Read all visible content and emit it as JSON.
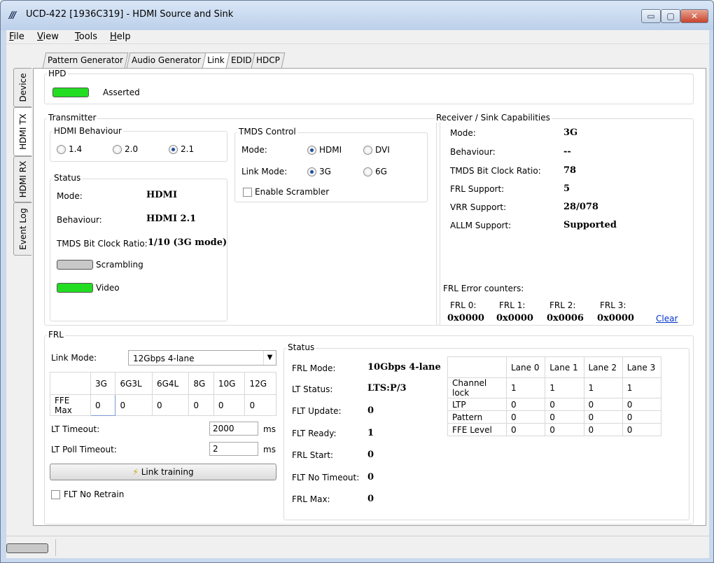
{
  "window": {
    "title": "UCD-422 [1936C319] - HDMI Source and Sink",
    "controls": {
      "minimize": "▭",
      "maximize": "▢",
      "close": "✕"
    }
  },
  "menu": [
    {
      "label": "File",
      "accel": "F",
      "rest": "ile"
    },
    {
      "label": "View",
      "accel": "V",
      "rest": "iew"
    },
    {
      "label": "Tools",
      "accel": "T",
      "rest": "ools"
    },
    {
      "label": "Help",
      "accel": "H",
      "rest": "elp"
    }
  ],
  "side_tabs": [
    "Device",
    "HDMI TX",
    "HDMI RX",
    "Event Log"
  ],
  "side_tab_active": "HDMI TX",
  "tabs": [
    "Pattern Generator",
    "Audio Generator",
    "Link",
    "EDID",
    "HDCP"
  ],
  "tab_active": "Link",
  "hpd": {
    "title": "HPD",
    "state": "Asserted",
    "led_color": "#22dd22"
  },
  "transmitter": {
    "title": "Transmitter",
    "behaviour": {
      "title": "HDMI Behaviour",
      "options": [
        "1.4",
        "2.0",
        "2.1"
      ],
      "selected": "2.1"
    },
    "status": {
      "title": "Status",
      "mode_label": "Mode:",
      "mode": "HDMI",
      "behaviour_label": "Behaviour:",
      "behaviour": "HDMI 2.1",
      "ratio_label": "TMDS Bit Clock Ratio:",
      "ratio": "1/10 (3G mode)",
      "scrambling_label": "Scrambling",
      "scrambling_led": "#c8c8c8",
      "video_label": "Video",
      "video_led": "#22dd22"
    },
    "tmds": {
      "title": "TMDS Control",
      "mode_label": "Mode:",
      "mode_options": [
        "HDMI",
        "DVI"
      ],
      "mode_selected": "HDMI",
      "link_label": "Link Mode:",
      "link_options": [
        "3G",
        "6G"
      ],
      "link_selected": "3G",
      "scrambler_label": "Enable Scrambler"
    }
  },
  "receiver": {
    "title": "Receiver / Sink Capabilities",
    "rows": [
      {
        "label": "Mode:",
        "value": "3G"
      },
      {
        "label": "Behaviour:",
        "value": "--"
      },
      {
        "label": "TMDS Bit Clock Ratio:",
        "value": "78"
      },
      {
        "label": "FRL Support:",
        "value": "5"
      },
      {
        "label": "VRR Support:",
        "value": "28/078"
      },
      {
        "label": "ALLM Support:",
        "value": "Supported"
      }
    ],
    "error_title": "FRL Error counters:",
    "errors": [
      {
        "label": "FRL 0:",
        "value": "0x0000"
      },
      {
        "label": "FRL 1:",
        "value": "0x0000"
      },
      {
        "label": "FRL 2:",
        "value": "0x0006"
      },
      {
        "label": "FRL 3:",
        "value": "0x0000"
      }
    ],
    "clear_label": "Clear"
  },
  "frl": {
    "title": "FRL",
    "link_mode_label": "Link Mode:",
    "link_mode_value": "12Gbps 4-lane",
    "ffe_headers": [
      "",
      "3G",
      "6G3L",
      "6G4L",
      "8G",
      "10G",
      "12G"
    ],
    "ffe_row": [
      "FFE Max",
      "0",
      "0",
      "0",
      "0",
      "0",
      "0"
    ],
    "lt_timeout_label": "LT Timeout:",
    "lt_timeout": "2000",
    "lt_timeout_unit": "ms",
    "lt_poll_label": "LT Poll Timeout:",
    "lt_poll": "2",
    "lt_poll_unit": "ms",
    "link_training_label": "Link training",
    "no_retrain_label": "FLT No Retrain"
  },
  "frl_status": {
    "title": "Status",
    "rows": [
      {
        "label": "FRL Mode:",
        "value": "10Gbps 4-lane"
      },
      {
        "label": "LT Status:",
        "value": "LTS:P/3"
      },
      {
        "label": "FLT Update:",
        "value": "0"
      },
      {
        "label": "FLT Ready:",
        "value": "1"
      },
      {
        "label": "FRL Start:",
        "value": "0"
      },
      {
        "label": "FLT No Timeout:",
        "value": "0"
      },
      {
        "label": "FRL Max:",
        "value": "0"
      }
    ],
    "lane_headers": [
      "",
      "Lane 0",
      "Lane 1",
      "Lane 2",
      "Lane 3"
    ],
    "lane_rows": [
      [
        "Channel lock",
        "1",
        "1",
        "1",
        "1"
      ],
      [
        "LTP",
        "0",
        "0",
        "0",
        "0"
      ],
      [
        "Pattern",
        "0",
        "0",
        "0",
        "0"
      ],
      [
        "FFE Level",
        "0",
        "0",
        "0",
        "0"
      ]
    ]
  }
}
